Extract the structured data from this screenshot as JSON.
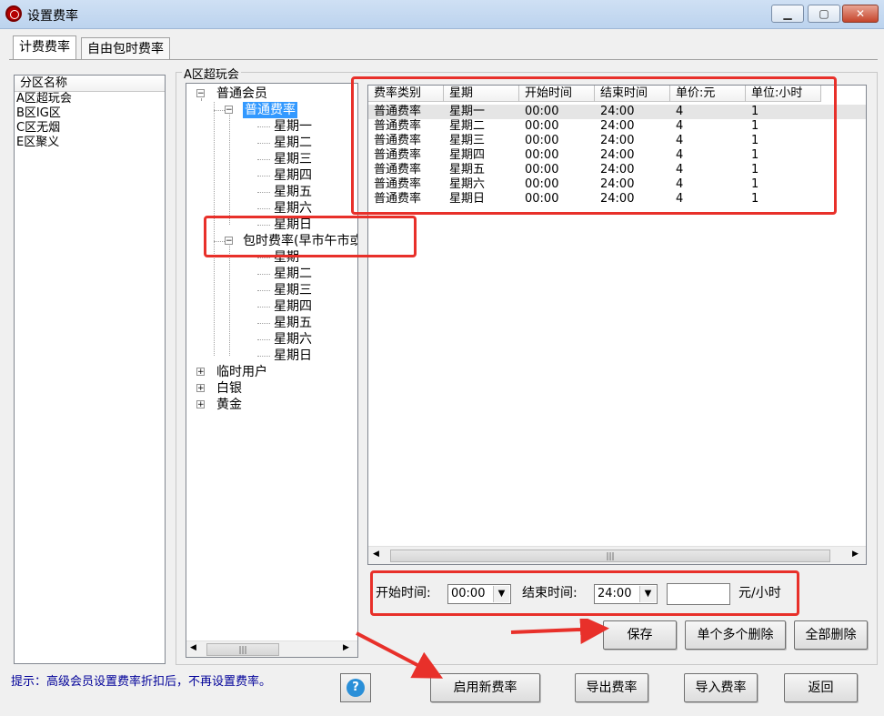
{
  "window": {
    "title": "设置费率",
    "min": "▁",
    "max": "▢",
    "close": "✕"
  },
  "tabs": [
    "计费费率",
    "自由包时费率"
  ],
  "zones": {
    "header": "分区名称",
    "items": [
      "A区超玩会",
      "B区IG区",
      "C区无烟",
      "E区聚义"
    ]
  },
  "group_title": "A区超玩会",
  "tree": {
    "members": [
      {
        "label": "普通会员",
        "expanded": true,
        "children": [
          {
            "label": "普通费率",
            "selected": true,
            "days": [
              "星期一",
              "星期二",
              "星期三",
              "星期四",
              "星期五",
              "星期六",
              "星期日"
            ]
          },
          {
            "label": "包时费率(早市午市或夜市)",
            "days": [
              "星期",
              "星期二",
              "星期三",
              "星期四",
              "星期五",
              "星期六",
              "星期日"
            ]
          }
        ]
      },
      {
        "label": "临时用户"
      },
      {
        "label": "白银"
      },
      {
        "label": "黄金"
      }
    ]
  },
  "table": {
    "columns": [
      "费率类别",
      "星期",
      "开始时间",
      "结束时间",
      "单价:元",
      "单位:小时"
    ],
    "rows": [
      [
        "普通费率",
        "星期一",
        "00:00",
        "24:00",
        "4",
        "1"
      ],
      [
        "普通费率",
        "星期二",
        "00:00",
        "24:00",
        "4",
        "1"
      ],
      [
        "普通费率",
        "星期三",
        "00:00",
        "24:00",
        "4",
        "1"
      ],
      [
        "普通费率",
        "星期四",
        "00:00",
        "24:00",
        "4",
        "1"
      ],
      [
        "普通费率",
        "星期五",
        "00:00",
        "24:00",
        "4",
        "1"
      ],
      [
        "普通费率",
        "星期六",
        "00:00",
        "24:00",
        "4",
        "1"
      ],
      [
        "普通费率",
        "星期日",
        "00:00",
        "24:00",
        "4",
        "1"
      ]
    ]
  },
  "form": {
    "start_label": "开始时间:",
    "start_value": "00:00",
    "end_label": "结束时间:",
    "end_value": "24:00",
    "price_value": "",
    "unit_label": "元/小时"
  },
  "buttons": {
    "save": "保存",
    "delete_some": "单个多个删除",
    "delete_all": "全部删除",
    "enable": "启用新费率",
    "export": "导出费率",
    "import": "导入费率",
    "back": "返回"
  },
  "hint": "提示：高级会员设置费率折扣后，不再设置费率。",
  "help_icon": "?",
  "colors": {
    "accent": "#e8302a",
    "selection": "#3399ff",
    "hint": "#000099"
  }
}
